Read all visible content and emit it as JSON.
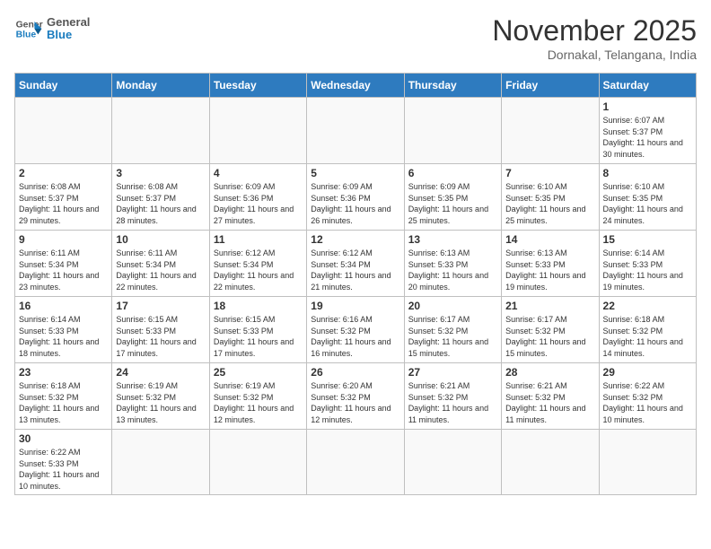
{
  "header": {
    "logo_general": "General",
    "logo_blue": "Blue",
    "month_title": "November 2025",
    "location": "Dornakal, Telangana, India"
  },
  "days_of_week": [
    "Sunday",
    "Monday",
    "Tuesday",
    "Wednesday",
    "Thursday",
    "Friday",
    "Saturday"
  ],
  "weeks": [
    [
      {
        "day": "",
        "info": ""
      },
      {
        "day": "",
        "info": ""
      },
      {
        "day": "",
        "info": ""
      },
      {
        "day": "",
        "info": ""
      },
      {
        "day": "",
        "info": ""
      },
      {
        "day": "",
        "info": ""
      },
      {
        "day": "1",
        "info": "Sunrise: 6:07 AM\nSunset: 5:37 PM\nDaylight: 11 hours\nand 30 minutes."
      }
    ],
    [
      {
        "day": "2",
        "info": "Sunrise: 6:08 AM\nSunset: 5:37 PM\nDaylight: 11 hours\nand 29 minutes."
      },
      {
        "day": "3",
        "info": "Sunrise: 6:08 AM\nSunset: 5:37 PM\nDaylight: 11 hours\nand 28 minutes."
      },
      {
        "day": "4",
        "info": "Sunrise: 6:09 AM\nSunset: 5:36 PM\nDaylight: 11 hours\nand 27 minutes."
      },
      {
        "day": "5",
        "info": "Sunrise: 6:09 AM\nSunset: 5:36 PM\nDaylight: 11 hours\nand 26 minutes."
      },
      {
        "day": "6",
        "info": "Sunrise: 6:09 AM\nSunset: 5:35 PM\nDaylight: 11 hours\nand 25 minutes."
      },
      {
        "day": "7",
        "info": "Sunrise: 6:10 AM\nSunset: 5:35 PM\nDaylight: 11 hours\nand 25 minutes."
      },
      {
        "day": "8",
        "info": "Sunrise: 6:10 AM\nSunset: 5:35 PM\nDaylight: 11 hours\nand 24 minutes."
      }
    ],
    [
      {
        "day": "9",
        "info": "Sunrise: 6:11 AM\nSunset: 5:34 PM\nDaylight: 11 hours\nand 23 minutes."
      },
      {
        "day": "10",
        "info": "Sunrise: 6:11 AM\nSunset: 5:34 PM\nDaylight: 11 hours\nand 22 minutes."
      },
      {
        "day": "11",
        "info": "Sunrise: 6:12 AM\nSunset: 5:34 PM\nDaylight: 11 hours\nand 22 minutes."
      },
      {
        "day": "12",
        "info": "Sunrise: 6:12 AM\nSunset: 5:34 PM\nDaylight: 11 hours\nand 21 minutes."
      },
      {
        "day": "13",
        "info": "Sunrise: 6:13 AM\nSunset: 5:33 PM\nDaylight: 11 hours\nand 20 minutes."
      },
      {
        "day": "14",
        "info": "Sunrise: 6:13 AM\nSunset: 5:33 PM\nDaylight: 11 hours\nand 19 minutes."
      },
      {
        "day": "15",
        "info": "Sunrise: 6:14 AM\nSunset: 5:33 PM\nDaylight: 11 hours\nand 19 minutes."
      }
    ],
    [
      {
        "day": "16",
        "info": "Sunrise: 6:14 AM\nSunset: 5:33 PM\nDaylight: 11 hours\nand 18 minutes."
      },
      {
        "day": "17",
        "info": "Sunrise: 6:15 AM\nSunset: 5:33 PM\nDaylight: 11 hours\nand 17 minutes."
      },
      {
        "day": "18",
        "info": "Sunrise: 6:15 AM\nSunset: 5:33 PM\nDaylight: 11 hours\nand 17 minutes."
      },
      {
        "day": "19",
        "info": "Sunrise: 6:16 AM\nSunset: 5:32 PM\nDaylight: 11 hours\nand 16 minutes."
      },
      {
        "day": "20",
        "info": "Sunrise: 6:17 AM\nSunset: 5:32 PM\nDaylight: 11 hours\nand 15 minutes."
      },
      {
        "day": "21",
        "info": "Sunrise: 6:17 AM\nSunset: 5:32 PM\nDaylight: 11 hours\nand 15 minutes."
      },
      {
        "day": "22",
        "info": "Sunrise: 6:18 AM\nSunset: 5:32 PM\nDaylight: 11 hours\nand 14 minutes."
      }
    ],
    [
      {
        "day": "23",
        "info": "Sunrise: 6:18 AM\nSunset: 5:32 PM\nDaylight: 11 hours\nand 13 minutes."
      },
      {
        "day": "24",
        "info": "Sunrise: 6:19 AM\nSunset: 5:32 PM\nDaylight: 11 hours\nand 13 minutes."
      },
      {
        "day": "25",
        "info": "Sunrise: 6:19 AM\nSunset: 5:32 PM\nDaylight: 11 hours\nand 12 minutes."
      },
      {
        "day": "26",
        "info": "Sunrise: 6:20 AM\nSunset: 5:32 PM\nDaylight: 11 hours\nand 12 minutes."
      },
      {
        "day": "27",
        "info": "Sunrise: 6:21 AM\nSunset: 5:32 PM\nDaylight: 11 hours\nand 11 minutes."
      },
      {
        "day": "28",
        "info": "Sunrise: 6:21 AM\nSunset: 5:32 PM\nDaylight: 11 hours\nand 11 minutes."
      },
      {
        "day": "29",
        "info": "Sunrise: 6:22 AM\nSunset: 5:32 PM\nDaylight: 11 hours\nand 10 minutes."
      }
    ],
    [
      {
        "day": "30",
        "info": "Sunrise: 6:22 AM\nSunset: 5:33 PM\nDaylight: 11 hours\nand 10 minutes."
      },
      {
        "day": "",
        "info": ""
      },
      {
        "day": "",
        "info": ""
      },
      {
        "day": "",
        "info": ""
      },
      {
        "day": "",
        "info": ""
      },
      {
        "day": "",
        "info": ""
      },
      {
        "day": "",
        "info": ""
      }
    ]
  ]
}
